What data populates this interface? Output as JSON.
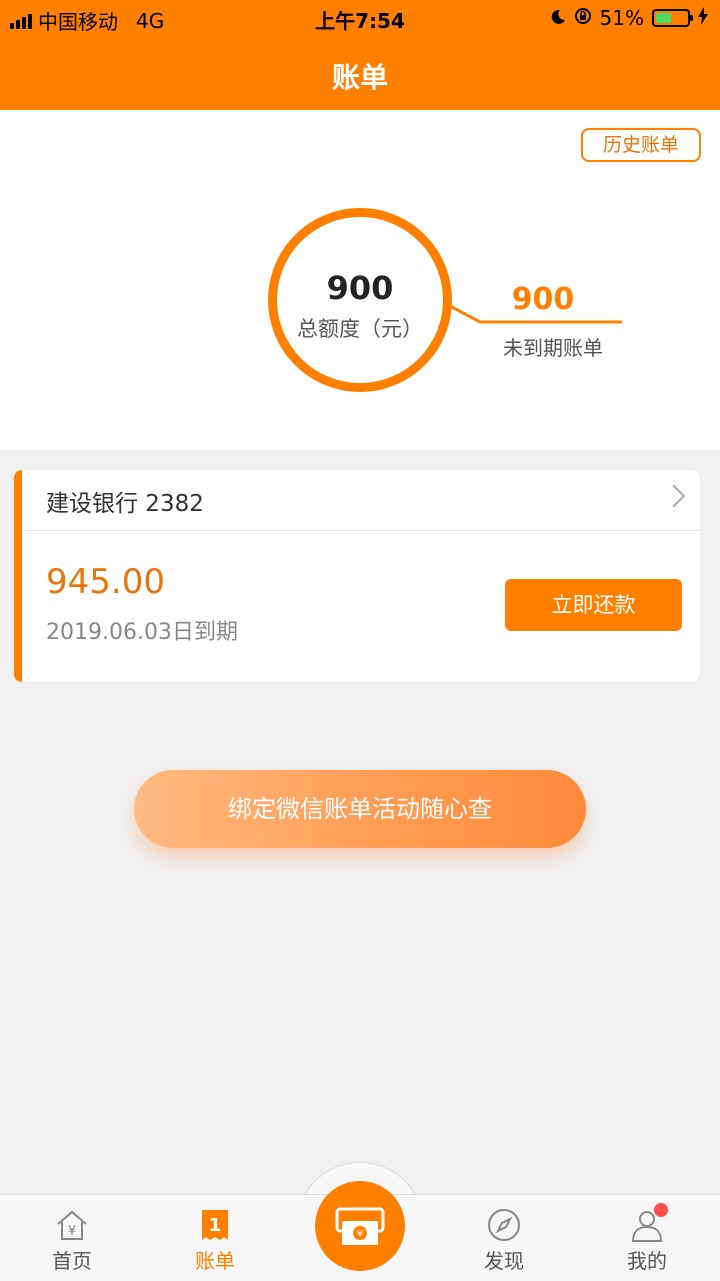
{
  "status_bar": {
    "carrier": "中国移动",
    "network": "4G",
    "time": "上午7:54",
    "battery_percent": "51%",
    "battery_level": 0.51,
    "battery_color": "#4cd964"
  },
  "header": {
    "title": "账单",
    "background": "#ff7f00"
  },
  "summary": {
    "history_button": "历史账单",
    "total_limit_value": "900",
    "total_limit_label": "总额度（元）",
    "unexpired_value": "900",
    "unexpired_label": "未到期账单"
  },
  "bill_card": {
    "bank": "建设银行 2382",
    "amount": "945.00",
    "due_date": "2019.06.03日到期",
    "pay_button": "立即还款"
  },
  "bind_button": "绑定微信账单活动随心查",
  "tab_bar": {
    "tabs": [
      {
        "label": "首页",
        "icon": "home-yen-icon",
        "active": false
      },
      {
        "label": "账单",
        "icon": "bill-icon",
        "active": true
      },
      {
        "label": "发现",
        "icon": "compass-icon",
        "active": false
      },
      {
        "label": "我的",
        "icon": "user-icon",
        "active": false
      }
    ],
    "center_icon": "cash-icon",
    "notification_dot_color": "#ff4d4f"
  }
}
